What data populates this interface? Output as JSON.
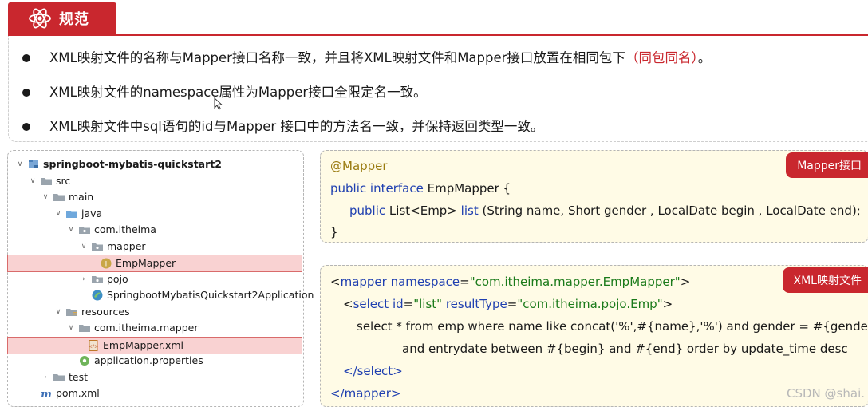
{
  "header": {
    "title": "规范"
  },
  "rules": [
    {
      "text": "XML映射文件的名称与Mapper接口名称一致，并且将XML映射文件和Mapper接口放置在相同包下",
      "emphasis": "（同包同名）",
      "tail": "。"
    },
    {
      "text": "XML映射文件的namespace属性为Mapper接口全限定名一致。",
      "emphasis": "",
      "tail": ""
    },
    {
      "text": "XML映射文件中sql语句的id与Mapper 接口中的方法名一致，并保持返回类型一致。",
      "emphasis": "",
      "tail": ""
    }
  ],
  "tree": {
    "items": [
      {
        "label": "springboot-mybatis-quickstart2",
        "icon": "project-icon",
        "expanded": true
      },
      {
        "label": "src",
        "icon": "folder-icon",
        "expanded": true
      },
      {
        "label": "main",
        "icon": "folder-icon",
        "expanded": true
      },
      {
        "label": "java",
        "icon": "folder-icon",
        "expanded": true
      },
      {
        "label": "com.itheima",
        "icon": "package-icon",
        "expanded": true
      },
      {
        "label": "mapper",
        "icon": "package-icon",
        "expanded": true
      },
      {
        "label": "EmpMapper",
        "icon": "interface-icon"
      },
      {
        "label": "pojo",
        "icon": "package-icon",
        "expanded": false
      },
      {
        "label": "SpringbootMybatisQuickstart2Application",
        "icon": "spring-class-icon"
      },
      {
        "label": "resources",
        "icon": "resources-folder-icon",
        "expanded": true
      },
      {
        "label": "com.itheima.mapper",
        "icon": "folder-icon",
        "expanded": true
      },
      {
        "label": "EmpMapper.xml",
        "icon": "xml-file-icon"
      },
      {
        "label": "application.properties",
        "icon": "properties-icon"
      },
      {
        "label": "test",
        "icon": "folder-icon",
        "expanded": false
      },
      {
        "label": "pom.xml",
        "icon": "maven-icon"
      }
    ]
  },
  "interface_panel": {
    "badge": "Mapper接口",
    "annotation": "@Mapper",
    "kw_public": "public",
    "kw_interface": "interface",
    "class_name": "EmpMapper {",
    "method_public": "public",
    "method_return": "List<Emp>",
    "method_name": "list",
    "method_params": "(String name, Short gender , LocalDate begin , LocalDate end);",
    "close": "}"
  },
  "xml_panel": {
    "badge": "XML映射文件",
    "open_lt": "<",
    "mapper_tag": "mapper",
    "ns_attr": "namespace",
    "eq": "=",
    "ns_value": "\"com.itheima.mapper.EmpMapper\"",
    "gt": ">",
    "select_tag": "select",
    "id_attr": "id",
    "id_value": "\"list\"",
    "rt_attr": "resultType",
    "rt_value": "\"com.itheima.pojo.Emp\"",
    "sql_line1": "select * from emp where name like concat('%',#{name},'%') and gender = #{gender}",
    "sql_line2": "and entrydate between #{begin} and #{end} order by update_time desc",
    "close_select": "</select>",
    "close_mapper": "</mapper>"
  },
  "watermark": "CSDN @shai.",
  "colors": {
    "accent": "#c9272e",
    "code_bg": "#fffbe6",
    "highlight": "#f9d2d2"
  }
}
